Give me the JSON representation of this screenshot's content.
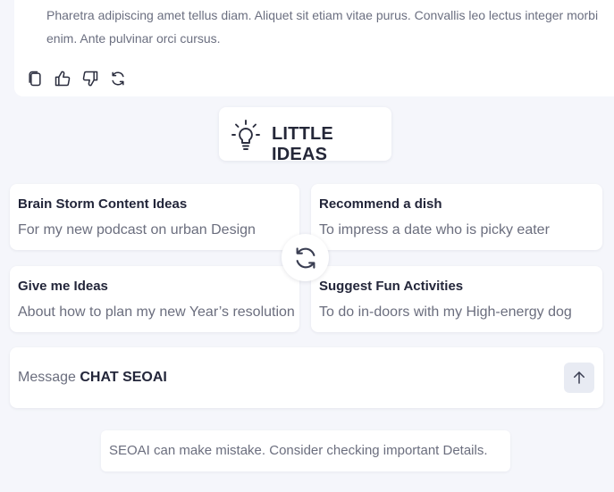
{
  "response": {
    "text": "Pharetra adipiscing amet tellus diam. Aliquet sit etiam vitae purus. Convallis leo lectus integer morbi enim. Ante pulvinar orci cursus."
  },
  "actions": [
    {
      "name": "copy-icon"
    },
    {
      "name": "thumbs-up-icon"
    },
    {
      "name": "thumbs-down-icon"
    },
    {
      "name": "regenerate-icon"
    }
  ],
  "ideas": {
    "title": "LITTLE IDEAS",
    "icon": "lightbulb-icon"
  },
  "suggestions": [
    {
      "title": "Brain Storm Content Ideas",
      "subtitle": "For my new podcast on urban Design"
    },
    {
      "title": "Recommend a dish",
      "subtitle": "To impress a date who is picky eater"
    },
    {
      "title": "Give me Ideas",
      "subtitle": "About how to plan my new Year’s resolution"
    },
    {
      "title": "Suggest Fun Activities",
      "subtitle": "To do in-doors with my High-energy dog"
    }
  ],
  "refresh": {
    "icon": "refresh-icon"
  },
  "message": {
    "prefix": "Message",
    "brand": "CHAT SEOAI",
    "send_icon": "arrow-up-icon"
  },
  "disclaimer": {
    "text": "SEOAI can make mistake. Consider checking important Details."
  },
  "colors": {
    "background": "#f5f6fb",
    "card": "#ffffff",
    "title_text": "#23263a",
    "muted_text": "#6b6e7e",
    "send_button": "#e8ebf3"
  }
}
